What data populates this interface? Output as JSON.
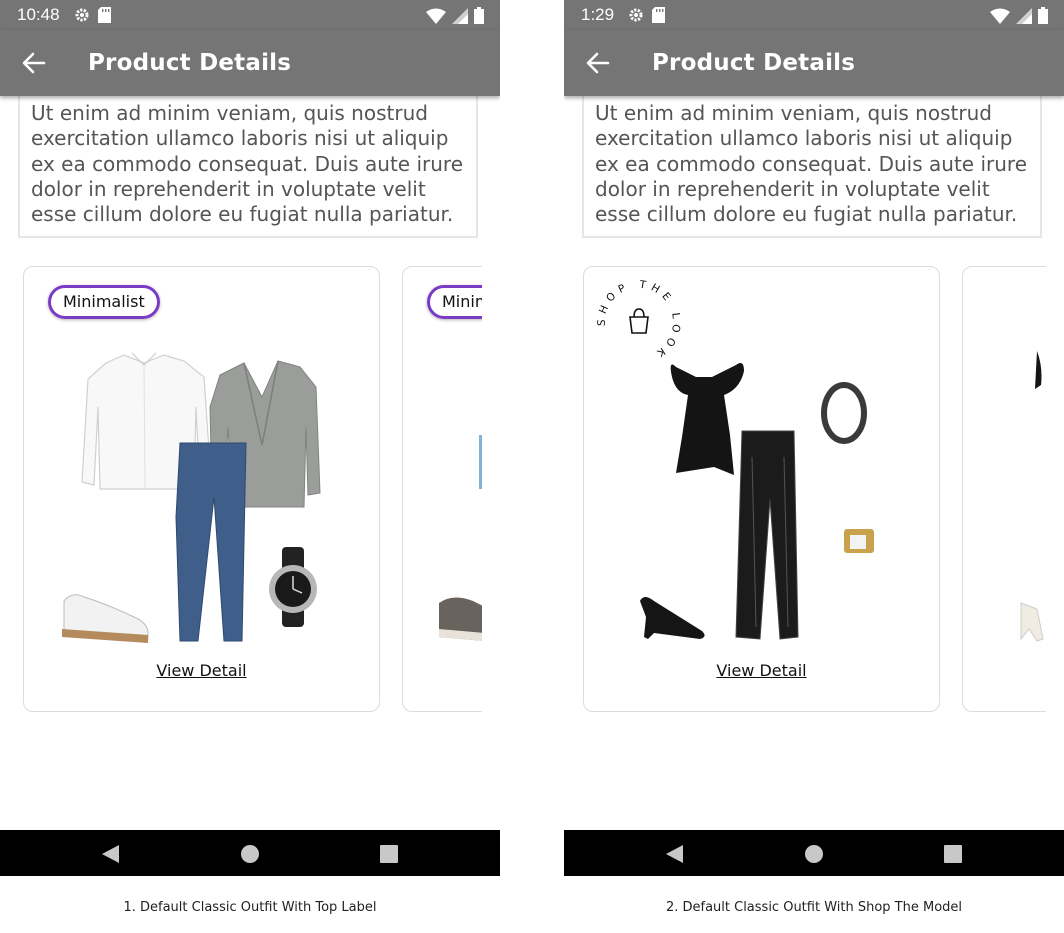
{
  "screens": [
    {
      "status_time": "10:48",
      "title": "Product Details",
      "description": "Ut enim ad minim veniam, quis nostrud exercitation ullamco laboris nisi ut aliquip ex ea commodo consequat. Duis aute irure dolor in reprehenderit in voluptate velit esse cillum dolore eu fugiat nulla pariatur.",
      "card": {
        "label": "Minimalist",
        "link": "View Detail"
      },
      "peek_label": "Minimalist",
      "caption": "1. Default Classic Outfit With Top Label"
    },
    {
      "status_time": "1:29",
      "title": "Product Details",
      "description": "Ut enim ad minim veniam, quis nostrud exercitation ullamco laboris nisi ut aliquip ex ea commodo consequat. Duis aute irure dolor in reprehenderit in voluptate velit esse cillum dolore eu fugiat nulla pariatur.",
      "card": {
        "badge_text": "SHOP THE LOOK",
        "link": "View Detail"
      },
      "caption": "2. Default Classic Outfit With Shop The Model"
    }
  ],
  "colors": {
    "bar": "#757575",
    "label_border": "#7a3cc4",
    "nav": "#000000"
  },
  "icons": [
    "back-arrow-icon",
    "settings-icon",
    "sd-card-icon",
    "wifi-icon",
    "signal-icon",
    "battery-icon",
    "nav-back-icon",
    "nav-home-icon",
    "nav-recents-icon",
    "shopping-bag-icon"
  ]
}
